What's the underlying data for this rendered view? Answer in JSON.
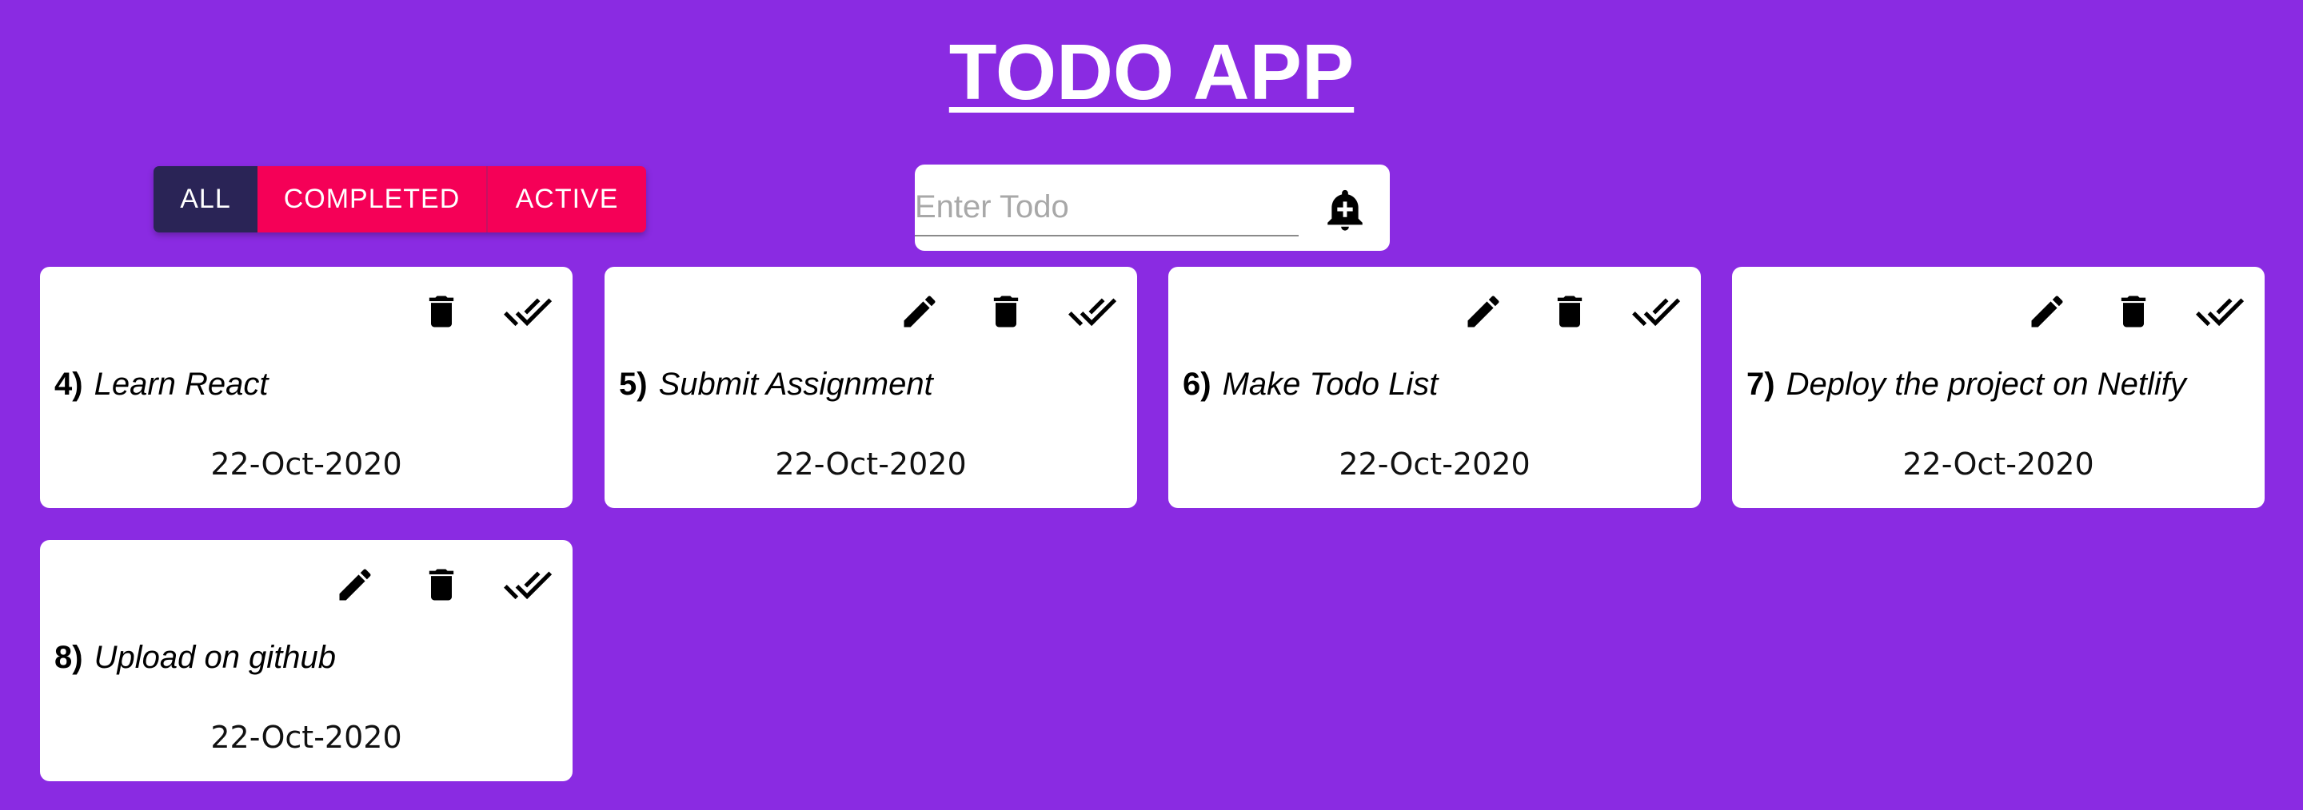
{
  "app": {
    "title": "TODO APP"
  },
  "filters": {
    "all": "ALL",
    "completed": "COMPLETED",
    "active": "ACTIVE",
    "selected": "ALL"
  },
  "input": {
    "placeholder": "Enter Todo",
    "value": ""
  },
  "colors": {
    "background": "#8a2be2",
    "filter_selected": "#2a2456",
    "filter_default": "#f50057",
    "card": "#ffffff"
  },
  "todos": [
    {
      "number": "4)",
      "text": "Learn React",
      "date": "22-Oct-2020",
      "editable": false
    },
    {
      "number": "5)",
      "text": "Submit Assignment",
      "date": "22-Oct-2020",
      "editable": true
    },
    {
      "number": "6)",
      "text": "Make Todo List",
      "date": "22-Oct-2020",
      "editable": true
    },
    {
      "number": "7)",
      "text": "Deploy the project on Netlify",
      "date": "22-Oct-2020",
      "editable": true
    },
    {
      "number": "8)",
      "text": "Upload on github",
      "date": "22-Oct-2020",
      "editable": true
    }
  ],
  "icons": {
    "add": "add-alert-icon",
    "edit": "pencil-icon",
    "delete": "trash-icon",
    "complete": "double-check-icon"
  }
}
